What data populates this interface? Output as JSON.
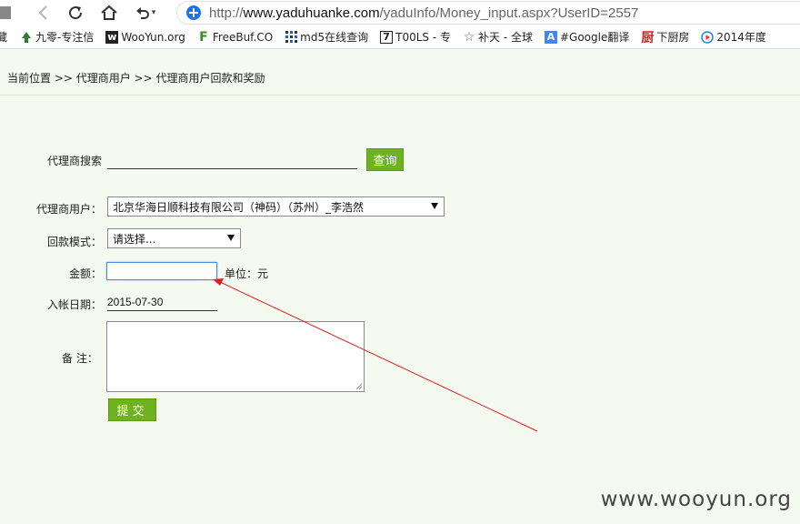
{
  "browser": {
    "url_protocol": "http://",
    "url_host": "www.yaduhuanke.com",
    "url_path": "/yaduInfo/Money_input.aspx?UserID=2557",
    "bookmarks": [
      {
        "label": "藏",
        "icon": "partial-bookmark-icon"
      },
      {
        "label": "九零-专注信",
        "icon": "tree-icon"
      },
      {
        "label": "WooYun.org",
        "icon": "wooyun-icon"
      },
      {
        "label": "FreeBuf.CO",
        "icon": "freebuf-icon"
      },
      {
        "label": "md5在线查询",
        "icon": "grid-icon"
      },
      {
        "label": "T00LS - 专",
        "icon": "tools-icon"
      },
      {
        "label": "补天 - 全球",
        "icon": "star-icon"
      },
      {
        "label": "#Google翻译",
        "icon": "translate-icon"
      },
      {
        "label": "下厨房",
        "icon": "kitchen-icon"
      },
      {
        "label": "2014年度",
        "icon": "play-icon"
      }
    ]
  },
  "breadcrumb": "当前位置 >> 代理商用户 >> 代理商用户回款和奖励",
  "form": {
    "search_label": "代理商搜索",
    "search_value": "",
    "query_button": "查询",
    "agent_label": "代理商用户：",
    "agent_value": "北京华海日顺科技有限公司（神码）（苏州）_李浩然",
    "mode_label": "回款模式：",
    "mode_value": "请选择...",
    "amount_label": "金额：",
    "amount_value": "",
    "unit_label": "单位：元",
    "date_label": "入帐日期：",
    "date_value": "2015-07-30",
    "notes_label": "备 注：",
    "notes_value": "",
    "submit_button": "提交"
  },
  "watermark": "www.wooyun.org",
  "colors": {
    "button_green": "#6fb21f",
    "page_background": "#f4faf0",
    "annotation_red": "#e02020",
    "focus_blue": "#4a90d9"
  }
}
